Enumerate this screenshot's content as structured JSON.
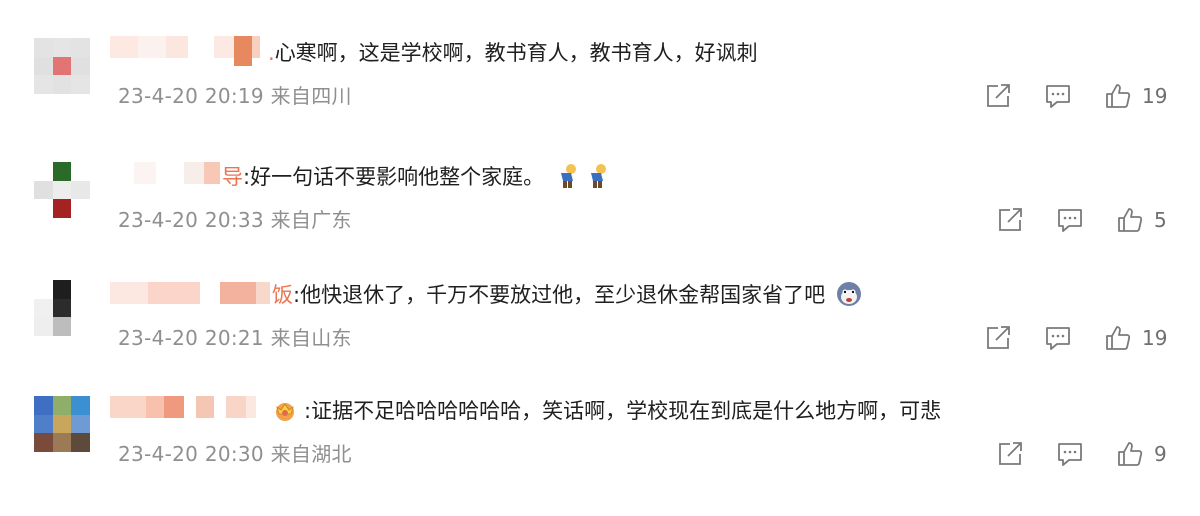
{
  "icons": {
    "share": "share-icon",
    "comment": "comment-icon",
    "like": "thumbs-up-icon"
  },
  "comments": [
    {
      "name_suffix": ".",
      "text": "心寒啊，这是学校啊，教书育人，教书育人，好讽刺",
      "time": "23-4-20 20:19",
      "location": "来自四川",
      "likes": "19"
    },
    {
      "name_suffix": "导",
      "text": ":好一句话不要影响他整个家庭。",
      "emoji": "bowing-man-emoji",
      "time": "23-4-20 20:33",
      "location": "来自广东",
      "likes": "5"
    },
    {
      "name_suffix": "饭",
      "text": ":他快退休了，千万不要放过他，至少退休金帮国家省了吧",
      "emoji": "angry-dog-emoji",
      "time": "23-4-20 20:21",
      "location": "来自山东",
      "likes": "19"
    },
    {
      "name_suffix": "",
      "text": ":证据不足哈哈哈哈哈哈，笑话啊，学校现在到底是什么地方啊，可悲",
      "emoji": "crown-badge-emoji",
      "time": "23-4-20 20:30",
      "location": "来自湖北",
      "likes": "9"
    }
  ]
}
